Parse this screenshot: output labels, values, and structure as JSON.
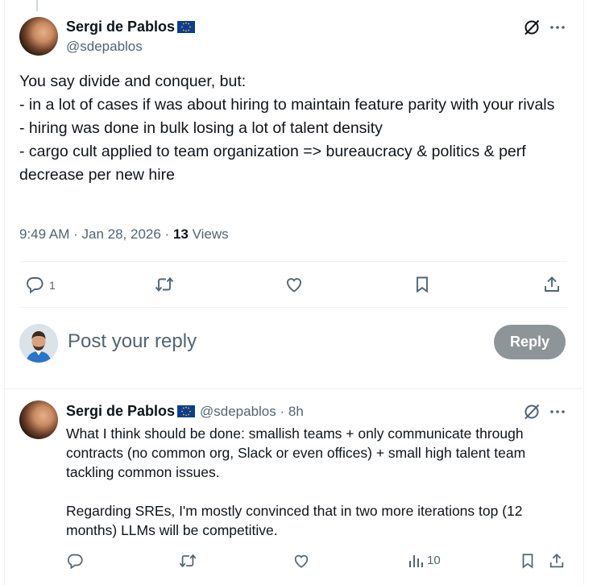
{
  "main_post": {
    "author_name": "Sergi de Pablos",
    "author_handle": "@sdepablos",
    "text": "You say divide and conquer, but:\n- in a lot of cases if was about hiring to maintain feature parity with your rivals\n- hiring was done in bulk losing a lot of talent density\n- cargo cult applied to team organization => bureaucracy & politics & perf decrease per new hire",
    "time": "9:49 AM",
    "date": "Jan 28, 2026",
    "views_count": "13",
    "views_label": "Views",
    "reply_count": "1"
  },
  "composer": {
    "placeholder": "Post your reply",
    "button_label": "Reply"
  },
  "reply_post": {
    "author_name": "Sergi de Pablos",
    "author_handle": "@sdepablos",
    "age": "8h",
    "text": "What I think should be done: smallish teams + only communicate through contracts (no common org, Slack or even offices) + small high talent team tackling common issues.\n\nRegarding SREs, I'm mostly convinced that in two more iterations top (12 months) LLMs will be competitive.",
    "views_count": "10"
  },
  "icons": [
    "grok-icon",
    "more-icon",
    "reply-icon",
    "repost-icon",
    "like-icon",
    "bookmark-icon",
    "share-icon",
    "views-icon",
    "eu-flag-icon"
  ],
  "colors": {
    "text_primary": "#0f1419",
    "text_secondary": "#536471",
    "divider": "#eff3f4",
    "eu_flag_blue": "#0b3d91",
    "eu_flag_stars": "#ffcc00",
    "reply_button_disabled": "#8e9599"
  }
}
